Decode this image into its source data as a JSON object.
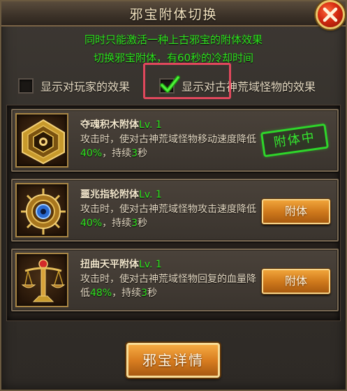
{
  "window": {
    "title": "邪宝附体切换"
  },
  "notice": {
    "line1": "同时只能激活一种上古邪宝的附体效果",
    "line2": "切换邪宝附体，有60秒的冷却时间"
  },
  "options": {
    "player": {
      "label": "显示对玩家的效果",
      "checked": false
    },
    "monster": {
      "label": "显示对古神荒域怪物的效果",
      "checked": true
    }
  },
  "items": [
    {
      "name": "夺魂积木附体",
      "level": "Lv. 1",
      "desc_a": "攻击时，使对古神荒域怪物移动速度降低",
      "value": "40%",
      "desc_b": "，持续",
      "duration": "3",
      "desc_c": "秒",
      "status": "附体中",
      "icon": "cursed-puzzle-icon"
    },
    {
      "name": "噩兆指轮附体",
      "level": "Lv. 1",
      "desc_a": "攻击时，使对古神荒域怪物攻击速度降低",
      "value": "40%",
      "desc_b": "，持续",
      "duration": "3",
      "desc_c": "秒",
      "button": "附体",
      "icon": "omen-ring-icon"
    },
    {
      "name": "扭曲天平附体",
      "level": "Lv. 1",
      "desc_a": "攻击时，使对古神荒域怪物回复的血量降低",
      "value": "48%",
      "desc_b": "，持续",
      "duration": "3",
      "desc_c": "秒",
      "button": "附体",
      "icon": "twisted-scale-icon"
    }
  ],
  "footer": {
    "details_button": "邪宝详情"
  },
  "colors": {
    "accent_green": "#2ee61e",
    "button_orange": "#d97e20",
    "highlight_red": "#e0485c"
  }
}
